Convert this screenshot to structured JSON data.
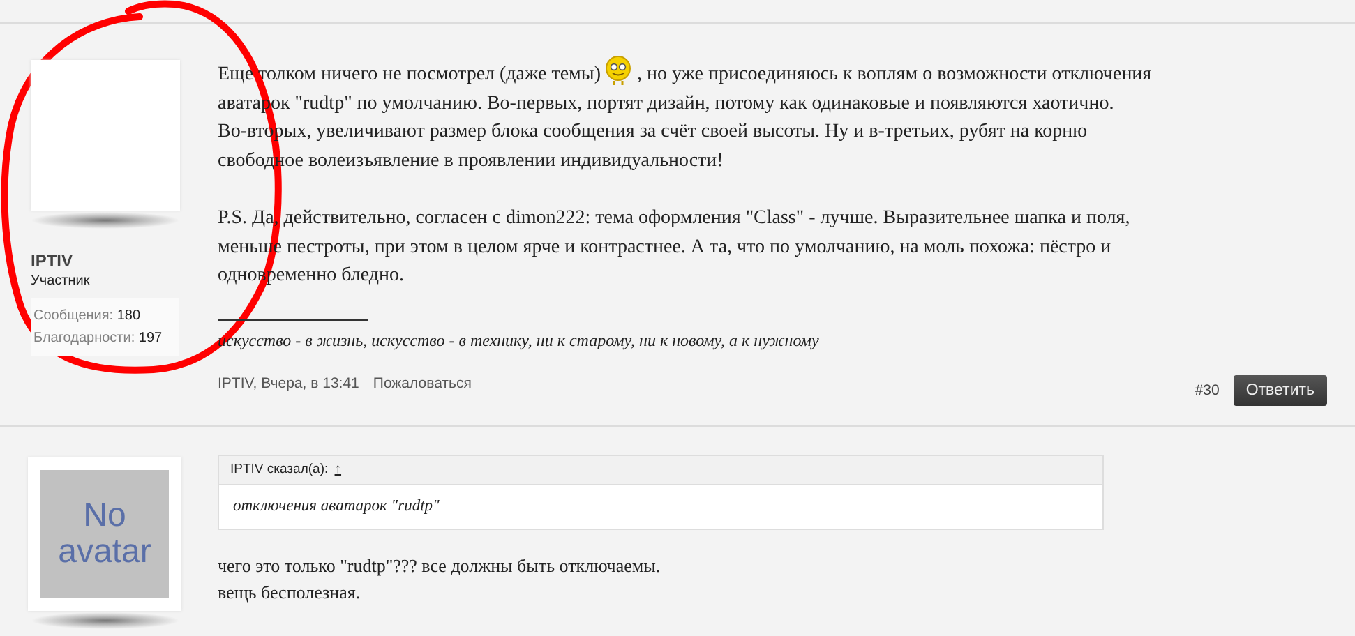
{
  "posts": [
    {
      "author": "IPTIV",
      "role": "Участник",
      "avatar": {
        "kind": "blank"
      },
      "stats": [
        {
          "label": "Сообщения:",
          "value": "180"
        },
        {
          "label": "Благодарности:",
          "value": "197"
        }
      ],
      "body": [
        {
          "segments": [
            {
              "kind": "text",
              "text": "Еще толком ничего не посмотрел (даже темы)"
            },
            {
              "kind": "emoji"
            },
            {
              "kind": "text",
              "text": ", но уже присоединяюсь к воплям о возможности отключения"
            },
            {
              "kind": "block",
              "text": "аватарок \"rudtp\" по умолчанию. Во-первых, портят дизайн, потому как одинаковые и появляются хаотично.\nВо-вторых, увеличивают размер блока сообщения за счёт своей высоты. Ну и в-третьих, рубят на корню\nсвободное волеизъявление в проявлении индивидуальности!"
            }
          ]
        },
        {
          "segments": [
            {
              "kind": "text",
              "text": "P.S. Да, действительно, согласен с dimon222: тема оформления \"Class\" - лучше. Выразительнее шапка и поля,\nменьше пестроты, при этом в целом ярче и контрастнее. А та, что по умолчанию, на моль похожа: пёстро и\nодновременно бледно."
            }
          ]
        }
      ],
      "signature": "искусство - в жизнь, искусство - в технику, ни к старому, ни к новому, а к нужному",
      "meta": "IPTIV, Вчера, в 13:41",
      "report": "Пожаловаться",
      "number": "#30",
      "reply": "Ответить"
    },
    {
      "avatar": {
        "kind": "none",
        "text": "No avatar"
      },
      "quote": {
        "header": "IPTIV сказал(а):",
        "link": "↑",
        "text": "отключения аватарок \"rudtp\""
      },
      "body": [
        {
          "segments": [
            {
              "kind": "text",
              "text": "чего это только \"rudtp\"??? все должны быть отключаемы.\nвещь бесполезная."
            }
          ]
        }
      ]
    }
  ]
}
